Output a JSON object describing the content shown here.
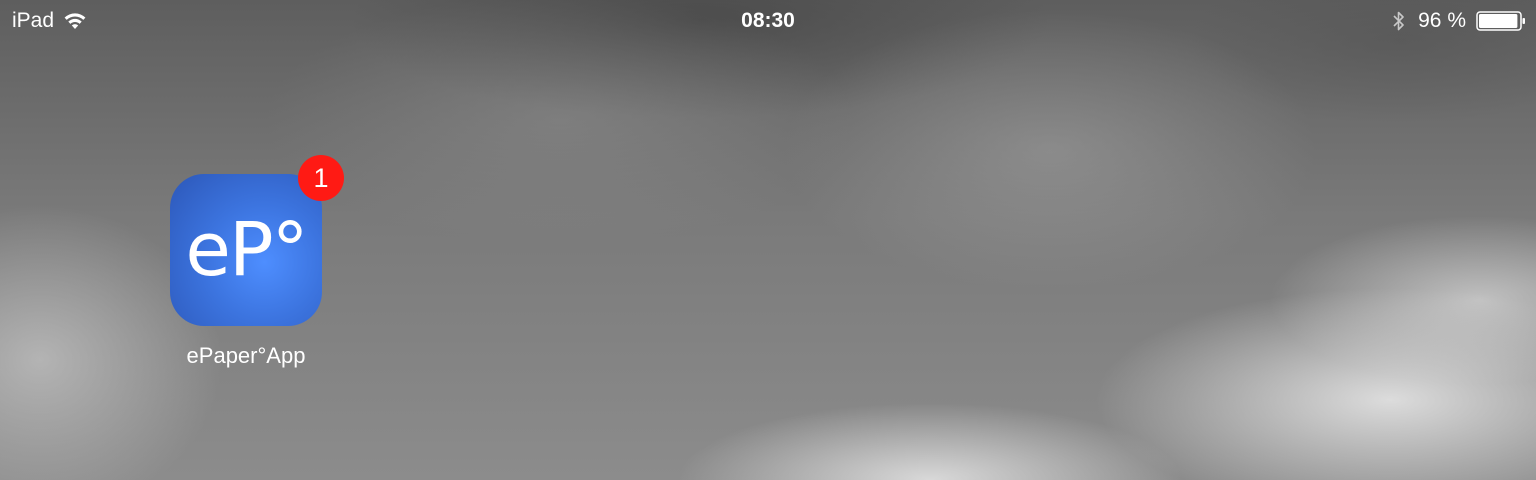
{
  "status_bar": {
    "device": "iPad",
    "time": "08:30",
    "battery": "96 %",
    "battery_level_percent": 96,
    "icons": [
      "wifi-icon",
      "bluetooth-icon",
      "battery-icon"
    ]
  },
  "home_screen": {
    "apps": [
      {
        "label": "ePaper°App",
        "icon_text": "eP°",
        "badge": "1",
        "icon_color": "#3c74df",
        "badge_color": "#ff1a14"
      }
    ]
  }
}
